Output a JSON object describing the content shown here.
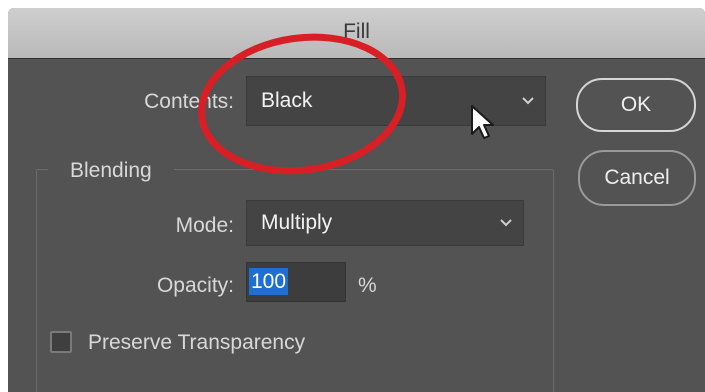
{
  "dialog": {
    "title": "Fill",
    "contents_label": "Contents:",
    "contents_value": "Black",
    "blending_label": "Blending",
    "mode_label": "Mode:",
    "mode_value": "Multiply",
    "opacity_label": "Opacity:",
    "opacity_value": "100",
    "percent_label": "%",
    "preserve_label": "Preserve Transparency",
    "preserve_checked": false
  },
  "buttons": {
    "ok": "OK",
    "cancel": "Cancel"
  },
  "colors": {
    "dialog_bg": "#535353",
    "highlight_circle": "#d81f26",
    "selection": "#1f6fd0"
  },
  "icons": {
    "dropdown": "chevron-down-icon",
    "cursor": "mouse-pointer-icon"
  }
}
